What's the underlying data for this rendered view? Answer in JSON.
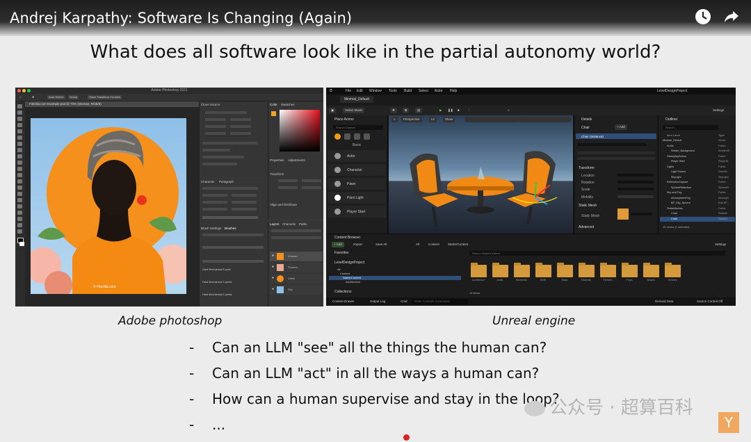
{
  "video": {
    "title": "Andrej Karpathy: Software Is Changing (Again)",
    "icons": [
      "watch-later-icon",
      "share-icon"
    ]
  },
  "slide": {
    "title": "What does all software look like in the partial autonomy world?",
    "captions": {
      "left": "Adobe photoshop",
      "right": "Unreal engine"
    },
    "bullets": [
      {
        "dash": "-",
        "text": "Can an LLM \"see\" all the things the human can?"
      },
      {
        "dash": "-",
        "text": "Can an LLM \"act\" in all the ways a human can?"
      },
      {
        "dash": "-",
        "text": "How can a human supervise and stay in the loop?"
      },
      {
        "dash": "-",
        "text": "..."
      }
    ]
  },
  "photoshop": {
    "window_title": "Adobe Photoshop 2021",
    "doc_tab": "Filezilla.com Example.psd @ 70% (Woman, RGB/8)",
    "options": [
      "Auto-Select:",
      "Group",
      "Show Transform Controls"
    ],
    "panels": {
      "clear_source": "Clone Source",
      "color": "Color",
      "swatches": "Swatches",
      "properties": "Properties",
      "adjustments": "Adjustments",
      "character": "Character",
      "paragraph": "Paragraph",
      "transform": "Transform",
      "align": "Align and Distribute",
      "brush_settings": "Brush Settings",
      "brushes": "Brushes",
      "layers": "Layers",
      "channels": "Channels",
      "paths": "Paths"
    },
    "brush_items": [
      "Hard Mechanical 5 pixel",
      "Hard Mechanical 3 pixels",
      "Hard Mechanical 5 pixels"
    ],
    "layers": [
      "Woman",
      "Flowers",
      "Circle",
      "Sky"
    ],
    "watermark": "© Filezilla.com",
    "colors": {
      "orange": "#f5901c",
      "sky": "#8fc0e8"
    }
  },
  "unreal": {
    "menu": [
      "File",
      "Edit",
      "Window",
      "Tools",
      "Build",
      "Select",
      "Actor",
      "Help"
    ],
    "project": "LevelDesignProject",
    "tab": "Minimal_Default",
    "toolbar": {
      "mode": "Select Mode",
      "settings": "Settings"
    },
    "viewport": {
      "perspective": "Perspective",
      "lit": "Lit",
      "show": "Show"
    },
    "place_actors": {
      "title": "Place Actors",
      "search": "Search Classes",
      "basic": "Basic",
      "items": [
        "Actor",
        "Character",
        "Pawn",
        "Point Light",
        "Player Start"
      ]
    },
    "details": {
      "title": "Details",
      "selected": "Chair",
      "instance": "Chair (Instance)",
      "add": "+ Add",
      "transform": "Transform",
      "rows": [
        "Location",
        "Rotation",
        "Scale",
        "Mobility"
      ],
      "static_mesh_section": "Static Mesh",
      "static_mesh": "Static Mesh",
      "advanced": "Advanced"
    },
    "outliner": {
      "title": "Outliner",
      "search": "Search...",
      "col_label": "Item Label",
      "col_type": "Type",
      "items": [
        {
          "label": "Minimal_Default",
          "type": "World"
        },
        {
          "label": "Audio",
          "type": "Folder"
        },
        {
          "label": "Starter_Background",
          "type": "AmbientS"
        },
        {
          "label": "GameplayActors",
          "type": "Folder"
        },
        {
          "label": "Player Start",
          "type": "PlayerSt"
        },
        {
          "label": "Lights",
          "type": "Folder"
        },
        {
          "label": "Light Source",
          "type": "Directio"
        },
        {
          "label": "SkyLight",
          "type": "SkyLight"
        },
        {
          "label": "ReflectionCapture",
          "type": "Folder"
        },
        {
          "label": "SphereReflection",
          "type": "SphereR"
        },
        {
          "label": "Sky and Fog",
          "type": "Folder"
        },
        {
          "label": "AtmosphericFog",
          "type": "Atmosph"
        },
        {
          "label": "BP_Sky_Sphere",
          "type": "Edit BP_"
        },
        {
          "label": "StaticMeshes",
          "type": "Folder"
        },
        {
          "label": "Chair",
          "type": "StaticM"
        },
        {
          "label": "Chair",
          "type": "StaticM"
        }
      ],
      "footer": "15 actors (1 selected)"
    },
    "content_browser": {
      "title": "Content Browser",
      "add": "+ Add",
      "import": "Import",
      "save_all": "Save All",
      "path": [
        "All",
        "Content",
        "StarterContent"
      ],
      "search": "Search StarterContent",
      "favorites": "Favorites",
      "project": "LevelDesignProject",
      "tree": [
        "All",
        "Content",
        "StarterContent",
        "Architecture"
      ],
      "collections": "Collections",
      "folders": [
        "Architecture",
        "Audio",
        "Blueprints",
        "HDRI",
        "Maps",
        "Materials",
        "Particles",
        "Props",
        "Shapes",
        "Textures"
      ],
      "item_count": "15 items",
      "settings": "Settings"
    },
    "status": {
      "content_drawer": "Content Drawer",
      "output_log": "Output Log",
      "cmd": "Cmd",
      "console_placeholder": "Enter Console Command",
      "derived_data": "Derived Data",
      "source_control": "Source Control Off"
    }
  },
  "watermark": {
    "text": "公众号 · 超算百科",
    "logo": "Y"
  }
}
